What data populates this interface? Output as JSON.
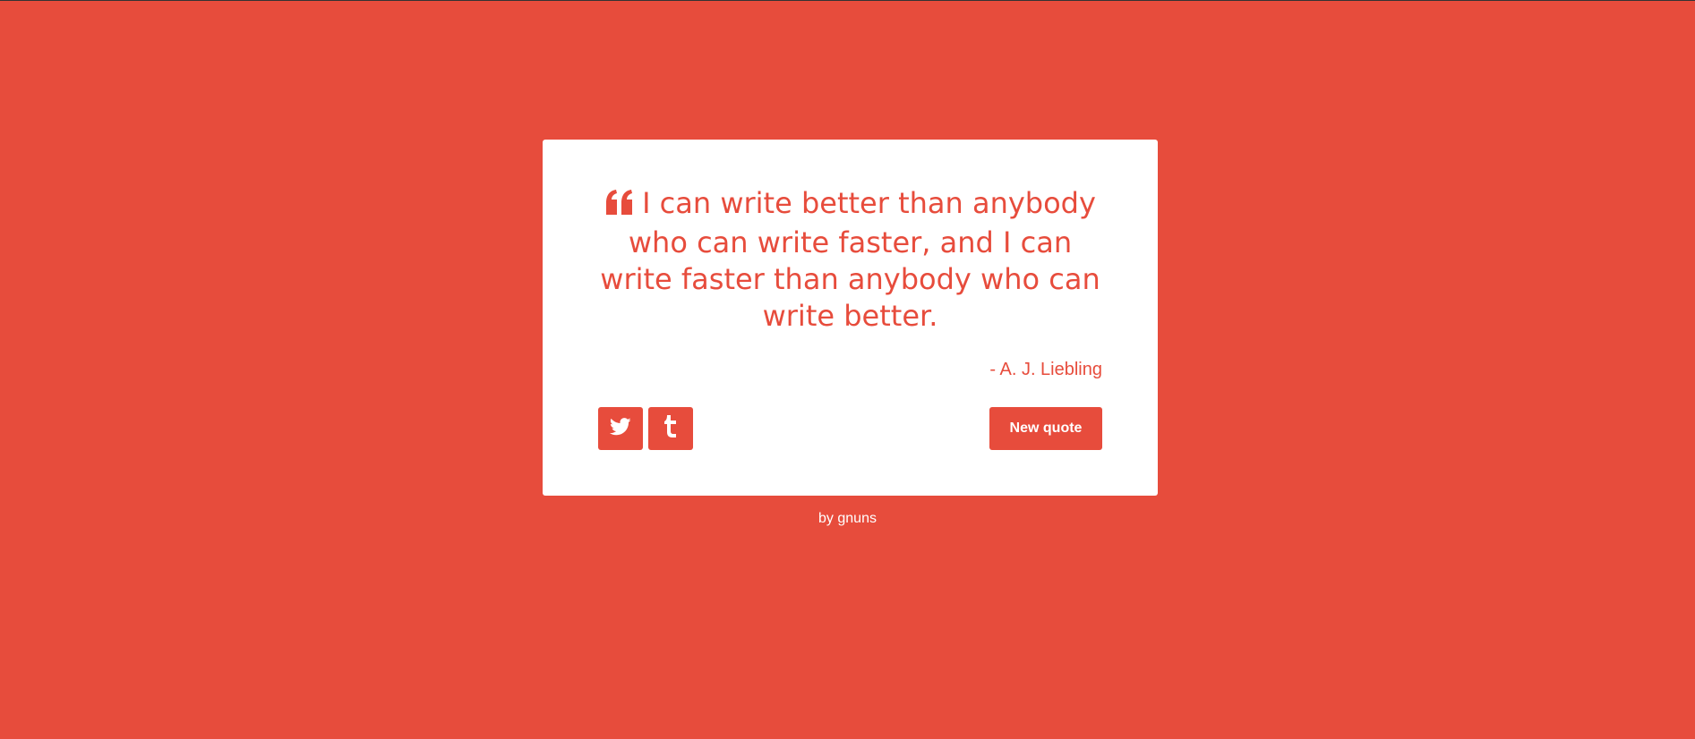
{
  "theme": {
    "accent": "#e74c3c",
    "card_background": "#ffffff"
  },
  "quote": {
    "icon": "quote-left-icon",
    "text": "I can write better than anybody who can write faster, and I can write faster than anybody who can write better.",
    "author": "- A. J. Liebling"
  },
  "actions": {
    "twitter_icon": "twitter-icon",
    "tumblr_icon": "tumblr-icon",
    "new_quote_label": "New quote"
  },
  "footer": {
    "prefix": "by ",
    "author_link": "gnuns"
  }
}
